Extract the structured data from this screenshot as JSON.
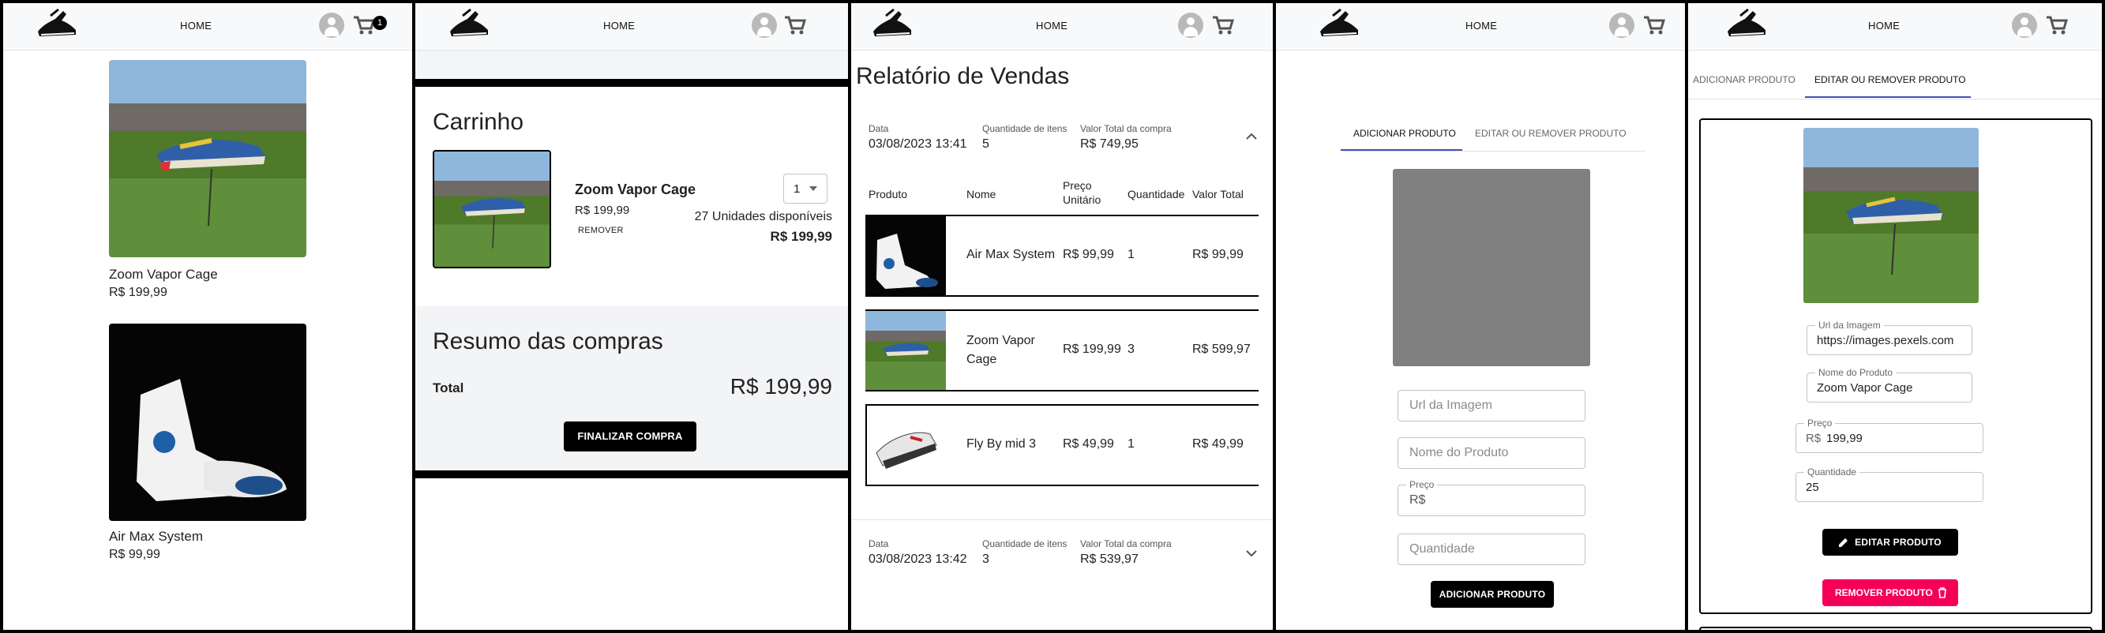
{
  "nav": {
    "home": "HOME",
    "cart_badge": "1"
  },
  "p1": {
    "products": [
      {
        "name": "Zoom Vapor Cage",
        "price": "R$ 199,99"
      },
      {
        "name": "Air Max System",
        "price": "R$ 99,99"
      }
    ]
  },
  "p2": {
    "title": "Carrinho",
    "item": {
      "name": "Zoom Vapor Cage",
      "price": "R$ 199,99",
      "remove": "REMOVER",
      "qty": "1",
      "stock": "27 Unidades disponíveis",
      "subtotal": "R$ 199,99"
    },
    "summary_title": "Resumo das compras",
    "total_label": "Total",
    "total_value": "R$ 199,99",
    "finalize": "FINALIZAR COMPRA"
  },
  "p3": {
    "title": "Relatório de Vendas",
    "head_labels": {
      "date": "Data",
      "qty": "Quantidade de itens",
      "total": "Valor Total da compra"
    },
    "sale1": {
      "date": "03/08/2023 13:41",
      "qty": "5",
      "total": "R$ 749,95"
    },
    "columns": {
      "product": "Produto",
      "name": "Nome",
      "unit": "Preço Unitário",
      "qty": "Quantidade",
      "total": "Valor Total"
    },
    "rows": [
      {
        "name": "Air Max System",
        "unit": "R$ 99,99",
        "qty": "1",
        "total": "R$ 99,99"
      },
      {
        "name": "Zoom Vapor Cage",
        "unit": "R$ 199,99",
        "qty": "3",
        "total": "R$ 599,97"
      },
      {
        "name": "Fly By mid 3",
        "unit": "R$ 49,99",
        "qty": "1",
        "total": "R$ 49,99"
      }
    ],
    "sale2": {
      "date": "03/08/2023 13:42",
      "qty": "3",
      "total": "R$ 539,97"
    }
  },
  "p4": {
    "tab_add": "ADICIONAR PRODUTO",
    "tab_edit": "EDITAR OU REMOVER PRODUTO",
    "url_ph": "Url da Imagem",
    "name_ph": "Nome do Produto",
    "price_label": "Preço",
    "price_prefix": "R$",
    "qty_ph": "Quantidade",
    "submit": "ADICIONAR PRODUTO"
  },
  "p5": {
    "tab_add": "ADICIONAR PRODUTO",
    "tab_edit": "EDITAR OU REMOVER PRODUTO",
    "url_label": "Url da Imagem",
    "url_value": "https://images.pexels.com",
    "name_label": "Nome do Produto",
    "name_value": "Zoom Vapor Cage",
    "price_label": "Preço",
    "price_prefix": "R$",
    "price_value": "199,99",
    "qty_label": "Quantidade",
    "qty_value": "25",
    "edit_btn": "EDITAR PRODUTO",
    "remove_btn": "REMOVER PRODUTO"
  },
  "colors": {
    "accent_blue": "#3f51b5",
    "danger": "#f50057",
    "placeholder_gray": "#808080"
  },
  "icons": [
    "shoe-logo-icon",
    "account-circle-icon",
    "shopping-cart-icon",
    "chevron-up-icon",
    "chevron-down-icon",
    "pencil-icon",
    "trash-icon",
    "dropdown-arrow-icon"
  ]
}
